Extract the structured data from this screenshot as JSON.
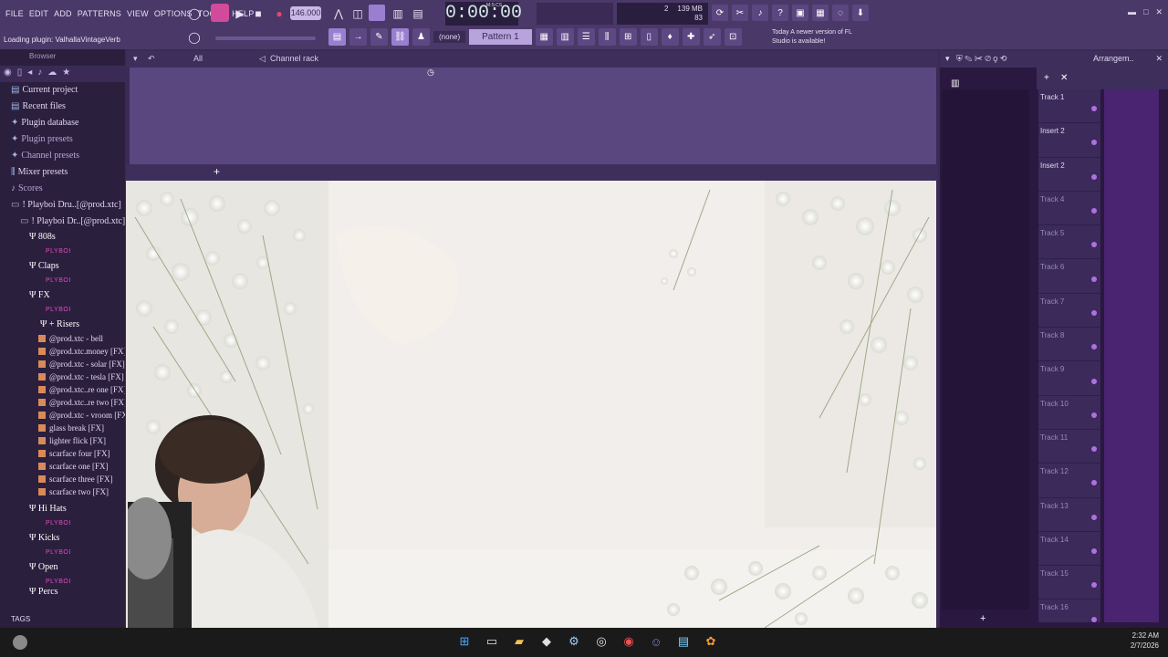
{
  "menu": [
    "FILE",
    "EDIT",
    "ADD",
    "PATTERNS",
    "VIEW",
    "OPTIONS",
    "TOOLS",
    "HELP"
  ],
  "transport": {
    "tempo": "146.000",
    "time": "0:00:00",
    "time_unit": "M:S:CS"
  },
  "cpu": {
    "mem": "139 MB",
    "poly": "83",
    "cpu_val": "2"
  },
  "hint": "Loading plugin: ValhallaVintageVerb",
  "toolbar2": {
    "snap": "(none)",
    "pattern": "Pattern 1"
  },
  "notice": {
    "label": "Today",
    "text": "A newer version of FL Studio is available!"
  },
  "browser": {
    "title": "Browser",
    "filter": "All",
    "items": [
      {
        "label": "Current project"
      },
      {
        "label": "Recent files"
      },
      {
        "label": "Plugin database"
      },
      {
        "label": "Plugin presets"
      },
      {
        "label": "Channel presets"
      },
      {
        "label": "Mixer presets"
      },
      {
        "label": "Scores"
      },
      {
        "label": "! Playboi Dru..[@prod.xtc]"
      },
      {
        "label": "! Playboi Dr..[@prod.xtc]"
      }
    ],
    "folders": {
      "f808": "808s",
      "claps": "Claps",
      "fx": "FX",
      "risers": "+ Risers",
      "hihats": "Hi Hats",
      "kicks": "Kicks",
      "open": "Open",
      "percs": "Percs"
    },
    "tag": "PLYBOI",
    "files": [
      "@prod.xtc - bell",
      "@prod.xtc.money [FX]",
      "@prod.xtc - solar [FX]",
      "@prod.xtc - tesla [FX]",
      "@prod.xtc..re one [FX]",
      "@prod.xtc..re two [FX]",
      "@prod.xtc - vroom [FX]",
      "glass break [FX]",
      "lighter flick [FX]",
      "scarface four [FX]",
      "scarface one [FX]",
      "scarface three [FX]",
      "scarface two [FX]"
    ],
    "tags_label": "TAGS"
  },
  "channel_rack": {
    "title": "Channel rack"
  },
  "playlist": {
    "title": "Arrangem..",
    "tracks": [
      "Track 1",
      "Insert 2",
      "Insert 2",
      "Track 4",
      "Track 5",
      "Track 6",
      "Track 7",
      "Track 8",
      "Track 9",
      "Track 10",
      "Track 11",
      "Track 12",
      "Track 13",
      "Track 14",
      "Track 15",
      "Track 16"
    ]
  },
  "clock": {
    "time": "2:32 AM",
    "date": "2/7/2026"
  }
}
